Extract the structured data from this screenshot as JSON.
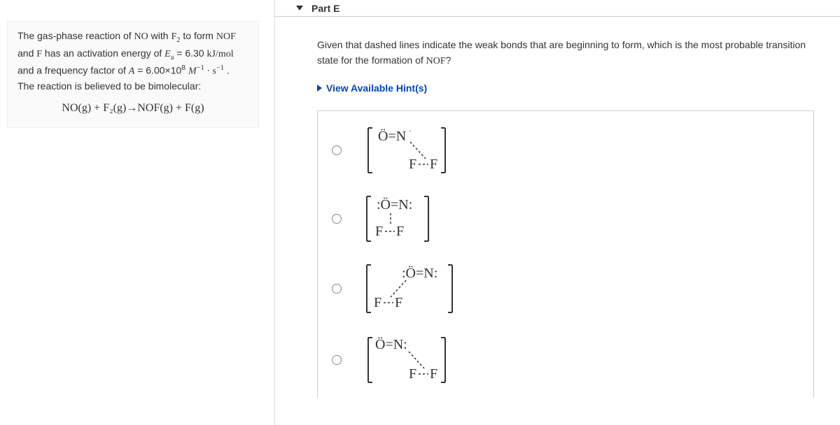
{
  "left": {
    "intro1": "The gas-phase reaction of ",
    "NO": "NO",
    "with": " with ",
    "F2": "F",
    "F2sub": "2",
    "toform": " to form ",
    "NOF": "NOF",
    "andF": " and ",
    "F": "F",
    "hasEa": " has an activation energy of ",
    "Ea": "E",
    "Easub": "a",
    "eq1": " = 6.30 ",
    "kjmol": "kJ/mol",
    "andA": " and a frequency factor of ",
    "A": "A",
    "eq2": " = 6.00×10",
    "exp8": "8",
    "units": "M",
    "neg1a": "−1",
    "dot": " · ",
    "s": "s",
    "neg1b": "−1",
    "rest": " . The reaction is believed to be bimolecular:",
    "equation": "NO(g) + F₂(g)→NOF(g) + F(g)"
  },
  "part": {
    "title": "Part E"
  },
  "right": {
    "question1": "Given that dashed lines indicate the weak bonds that are beginning to form, which is the most probable transition state for the formation of ",
    "questionNOF": "NOF",
    "question2": "?",
    "hints": "View Available Hint(s)"
  },
  "options": {
    "a_top": "Ö=N·",
    "a_bot": "F—F",
    "b_top": ":Ö=N:",
    "b_bot": "F—F",
    "c_top": ":Ö=N:",
    "c_bot": "F—F",
    "d_top": "Ö=N:",
    "d_bot": "F—F"
  }
}
